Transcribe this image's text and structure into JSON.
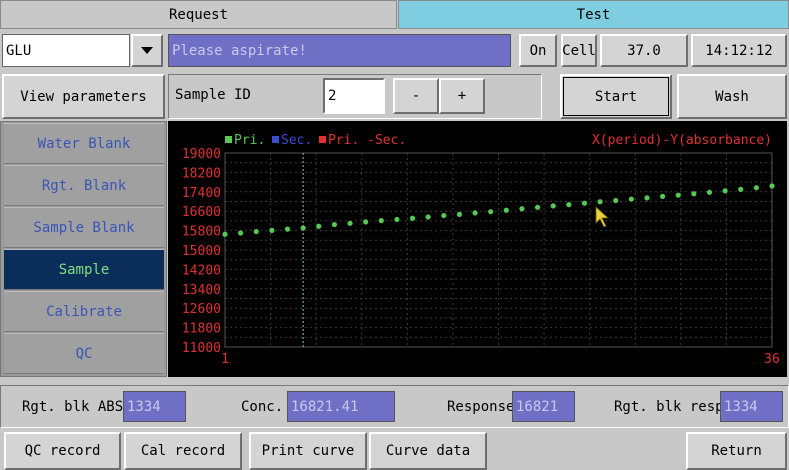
{
  "tabs": [
    {
      "label": "Request",
      "active": false
    },
    {
      "label": "Test",
      "active": true
    }
  ],
  "test_select": {
    "value": "GLU"
  },
  "status_message": "Please aspirate!",
  "toolbar": {
    "on_label": "On",
    "cell_label": "Cell",
    "temperature": "37.0",
    "time": "14:12:12"
  },
  "sample_controls": {
    "view_params_label": "View parameters",
    "sample_id_label": "Sample ID",
    "sample_id_value": "2",
    "minus_label": "-",
    "plus_label": "+",
    "start_label": "Start",
    "wash_label": "Wash"
  },
  "sidebar": {
    "items": [
      {
        "label": "Water Blank",
        "active": false
      },
      {
        "label": "Rgt. Blank",
        "active": false
      },
      {
        "label": "Sample Blank",
        "active": false
      },
      {
        "label": "Sample",
        "active": true
      },
      {
        "label": "Calibrate",
        "active": false
      },
      {
        "label": "QC",
        "active": false
      }
    ]
  },
  "results": {
    "rgt_blk_abs_label": "Rgt. blk ABS",
    "rgt_blk_abs_value": "1334",
    "conc_label": "Conc.",
    "conc_value": "16821.41",
    "response_label": "Response",
    "response_value": "16821",
    "rgt_blk_resp_label": "Rgt. blk resp",
    "rgt_blk_resp_value": "1334"
  },
  "bottom_buttons": {
    "qc_record": "QC record",
    "cal_record": "Cal record",
    "print_curve": "Print curve",
    "curve_data": "Curve data",
    "return": "Return"
  },
  "colors": {
    "primary_series": "#55c855",
    "secondary_series": "#3c4cd0",
    "difference_series": "#e03030",
    "axis_text": "#e03030",
    "active_tab": "#7fcde0",
    "plot_bg": "#000000"
  },
  "chart_data": {
    "type": "scatter",
    "title": "X(period)-Y(absorbance)",
    "legend": [
      {
        "name": "Pri.",
        "color": "#55c855"
      },
      {
        "name": "Sec.",
        "color": "#3c4cd0"
      },
      {
        "name": "Pri. -Sec.",
        "color": "#e03030"
      }
    ],
    "legend_position": "top-left",
    "xlim": [
      1,
      36
    ],
    "x_tick_labels": [
      "1",
      "36"
    ],
    "ylim": [
      11000,
      19000
    ],
    "y_ticks": [
      19000,
      18200,
      17400,
      16600,
      15800,
      15000,
      14200,
      13400,
      12600,
      11800,
      11000
    ],
    "y_tick_labels": [
      "19000",
      "18200",
      "17400",
      "16600",
      "15800",
      "15000",
      "14200",
      "13400",
      "12600",
      "11800",
      "11000"
    ],
    "y_gridlines": [
      19000,
      18600,
      18200,
      17800,
      17400,
      17000,
      16600,
      16200,
      15800,
      15400,
      15000,
      14600,
      14200,
      13800,
      13400,
      13000,
      12600,
      12200,
      11800,
      11400,
      11000
    ],
    "grid": true,
    "marker_x": 6,
    "series": [
      {
        "name": "Pri.",
        "x": [
          1,
          2,
          3,
          4,
          5,
          6,
          7,
          8,
          9,
          10,
          11,
          12,
          13,
          14,
          15,
          16,
          17,
          18,
          19,
          20,
          21,
          22,
          23,
          24,
          25,
          26,
          27,
          28,
          29,
          30,
          31,
          32,
          33,
          34,
          35,
          36
        ],
        "y": [
          15650,
          15700,
          15760,
          15810,
          15860,
          15910,
          15980,
          16050,
          16100,
          16160,
          16210,
          16260,
          16310,
          16360,
          16420,
          16470,
          16530,
          16580,
          16640,
          16700,
          16760,
          16820,
          16870,
          16930,
          16990,
          17040,
          17100,
          17150,
          17210,
          17260,
          17320,
          17380,
          17440,
          17500,
          17570,
          17640
        ]
      }
    ]
  }
}
